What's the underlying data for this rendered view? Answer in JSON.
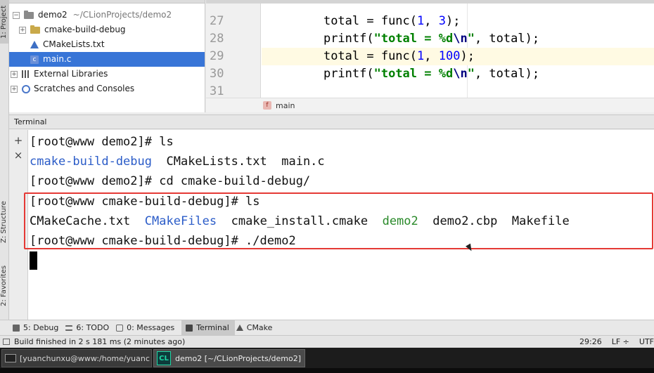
{
  "sidebar_tabs": {
    "project": "1: Project",
    "structure": "Z: Structure",
    "favorites": "2: Favorites"
  },
  "project_tree": {
    "root": {
      "name": "demo2",
      "path": "~/CLionProjects/demo2"
    },
    "items": [
      {
        "label": "cmake-build-debug",
        "icon": "folder-icon"
      },
      {
        "label": "CMakeLists.txt",
        "icon": "cmake-icon"
      },
      {
        "label": "main.c",
        "icon": "c-file-icon"
      }
    ],
    "external_libraries": "External Libraries",
    "scratches": "Scratches and Consoles"
  },
  "editor": {
    "line_numbers": [
      "27",
      "28",
      "29",
      "30",
      "31"
    ],
    "lines": [
      {
        "indent": "    ",
        "pre": "total = func(",
        "n1": "1",
        "mid": ", ",
        "n2": "3",
        "post": ");"
      },
      {
        "indent": "    ",
        "fn": "printf(",
        "str": "\"total = %d",
        "esc": "\\n",
        "strend": "\"",
        "post": ", total);"
      },
      {
        "indent": "    ",
        "pre": "total = func(",
        "n1": "1",
        "mid": ", ",
        "n2": "100",
        "post": ");"
      },
      {
        "indent": "    ",
        "fn": "printf(",
        "str": "\"total = %d",
        "esc": "\\n",
        "strend": "\"",
        "post": ", total);"
      }
    ],
    "breadcrumb": "main",
    "breadcrumb_badge": "f"
  },
  "terminal": {
    "header": "Terminal",
    "lines": [
      "[root@www demo2]# ls",
      "",
      "[root@www demo2]# cd cmake-build-debug/",
      "[root@www cmake-build-debug]# ls",
      "",
      "[root@www cmake-build-debug]# ./demo2"
    ],
    "ls1": {
      "dir": "cmake-build-debug",
      "files": "CMakeLists.txt  main.c"
    },
    "ls2": {
      "f1": "CMakeCache.txt",
      "d1": "CMakeFiles",
      "f2": "cmake_install.cmake",
      "e1": "demo2",
      "f3": "demo2.cbp",
      "f4": "Makefile"
    }
  },
  "tool_windows": [
    {
      "label": "5: Debug"
    },
    {
      "label": "6: TODO"
    },
    {
      "label": "0: Messages"
    },
    {
      "label": "Terminal"
    },
    {
      "label": "CMake"
    }
  ],
  "status": {
    "message": "Build finished in 2 s 181 ms (2 minutes ago)",
    "position": "29:26",
    "line_sep": "LF ÷",
    "encoding": "UTF"
  },
  "taskbar": {
    "terminal_window": "[yuanchunxu@www:/home/yuanc",
    "clion_window": "demo2 [~/CLionProjects/demo2]"
  },
  "colors": {
    "selection": "#3875d7",
    "directory": "#2b5cc8",
    "executable": "#2a8a2a",
    "highlight_box": "#e53935"
  }
}
